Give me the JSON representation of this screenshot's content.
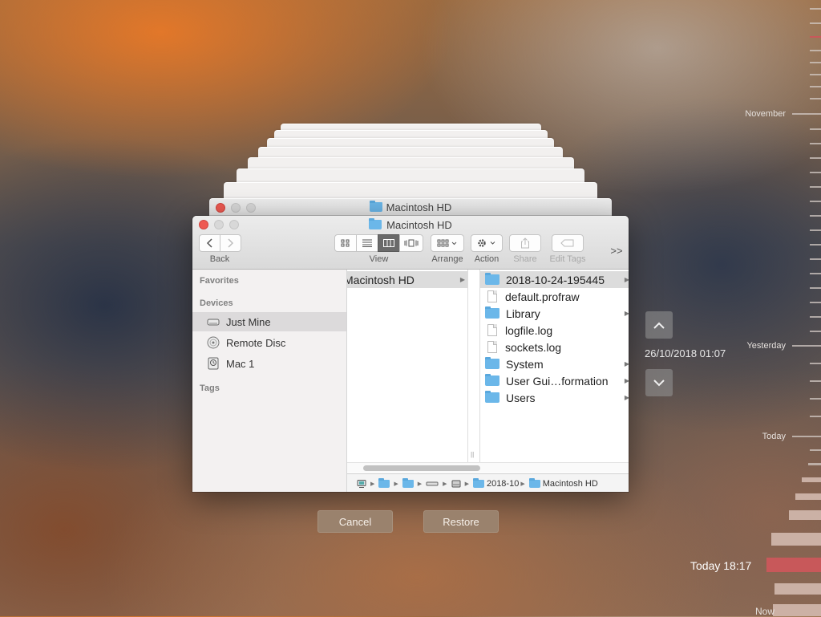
{
  "window": {
    "title": "Macintosh HD",
    "ghost_title": "Macintosh HD"
  },
  "toolbar": {
    "back_label": "Back",
    "view_label": "View",
    "arrange_label": "Arrange",
    "action_label": "Action",
    "share_label": "Share",
    "edit_tags_label": "Edit Tags",
    "overflow": ">>"
  },
  "sidebar": {
    "favorites": "Favorites",
    "devices": "Devices",
    "tags": "Tags",
    "items": [
      {
        "label": "Just Mine",
        "icon": "drive-icon",
        "selected": true
      },
      {
        "label": "Remote Disc",
        "icon": "disc-icon",
        "selected": false
      },
      {
        "label": "Mac 1",
        "icon": "timemachine-drive-icon",
        "selected": false
      }
    ]
  },
  "columns": {
    "col1_item": "Macintosh HD",
    "col2_items": [
      {
        "label": "2018-10-24-195445",
        "type": "folder",
        "selected": true
      },
      {
        "label": "default.profraw",
        "type": "file"
      },
      {
        "label": "Library",
        "type": "folder"
      },
      {
        "label": "logfile.log",
        "type": "file"
      },
      {
        "label": "sockets.log",
        "type": "file"
      },
      {
        "label": "System",
        "type": "folder"
      },
      {
        "label": "User Gui…formation",
        "type": "folder"
      },
      {
        "label": "Users",
        "type": "folder"
      }
    ]
  },
  "pathbar": {
    "seg1": "2018-10",
    "seg2": "Macintosh HD"
  },
  "buttons": {
    "cancel": "Cancel",
    "restore": "Restore"
  },
  "navigation": {
    "date": "26/10/2018 01:07"
  },
  "timeline": {
    "november": "November",
    "yesterday": "Yesterday",
    "today": "Today",
    "current": "Today 18:17",
    "now": "Now"
  },
  "colors": {
    "accent_red": "#c8585a",
    "button_bg": "#9a826d",
    "folder_blue": "#6bb7e9"
  }
}
